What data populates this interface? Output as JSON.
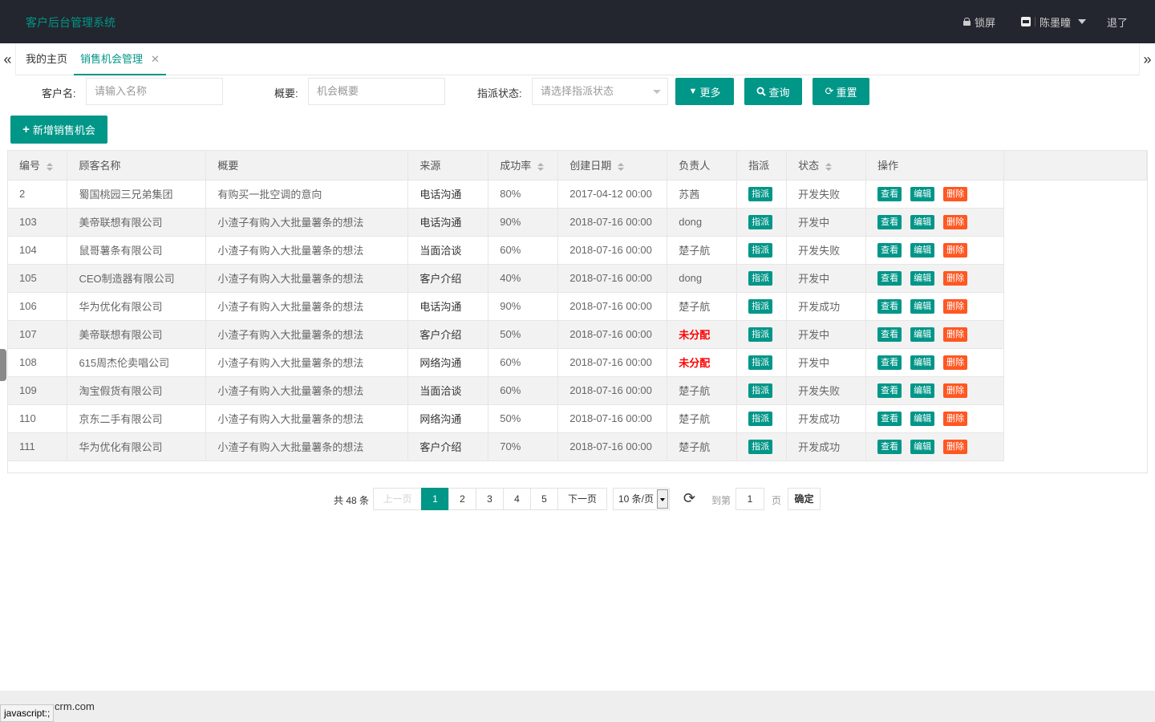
{
  "header": {
    "title": "客户后台管理系统",
    "lock": "锁屏",
    "user": "陈墨瞳",
    "logout": "退了"
  },
  "tabs": {
    "home": "我的主页",
    "active": "销售机会管理",
    "close": "✕"
  },
  "search": {
    "customer_label": "客户名:",
    "customer_placeholder": "请输入名称",
    "summary_label": "概要:",
    "summary_placeholder": "机会概要",
    "status_label": "指派状态:",
    "status_placeholder": "请选择指派状态",
    "more": "更多",
    "query": "查询",
    "reset": "重置"
  },
  "add_button": "新增销售机会",
  "table": {
    "headers": [
      "编号",
      "顾客名称",
      "概要",
      "来源",
      "成功率",
      "创建日期",
      "负责人",
      "指派",
      "状态",
      "操作"
    ],
    "rows": [
      {
        "id": "2",
        "name": "蜀国桃园三兄弟集团",
        "summary": "有购买一批空调的意向",
        "source": "电话沟通",
        "rate": "80%",
        "date": "2017-04-12 00:00",
        "owner": "苏茜",
        "status": "开发失败"
      },
      {
        "id": "103",
        "name": "美帝联想有限公司",
        "summary": "小渣子有购入大批量薯条的想法",
        "source": "电话沟通",
        "rate": "90%",
        "date": "2018-07-16 00:00",
        "owner": "dong",
        "status": "开发中"
      },
      {
        "id": "104",
        "name": "鼠哥薯条有限公司",
        "summary": "小渣子有购入大批量薯条的想法",
        "source": "当面洽谈",
        "rate": "60%",
        "date": "2018-07-16 00:00",
        "owner": "楚子航",
        "status": "开发失败"
      },
      {
        "id": "105",
        "name": "CEO制造器有限公司",
        "summary": "小渣子有购入大批量薯条的想法",
        "source": "客户介绍",
        "rate": "40%",
        "date": "2018-07-16 00:00",
        "owner": "dong",
        "status": "开发中"
      },
      {
        "id": "106",
        "name": "华为优化有限公司",
        "summary": "小渣子有购入大批量薯条的想法",
        "source": "电话沟通",
        "rate": "90%",
        "date": "2018-07-16 00:00",
        "owner": "楚子航",
        "status": "开发成功"
      },
      {
        "id": "107",
        "name": "美帝联想有限公司",
        "summary": "小渣子有购入大批量薯条的想法",
        "source": "客户介绍",
        "rate": "50%",
        "date": "2018-07-16 00:00",
        "owner": "未分配",
        "status": "开发中"
      },
      {
        "id": "108",
        "name": "615周杰伦卖唱公司",
        "summary": "小渣子有购入大批量薯条的想法",
        "source": "网络沟通",
        "rate": "60%",
        "date": "2018-07-16 00:00",
        "owner": "未分配",
        "status": "开发中"
      },
      {
        "id": "109",
        "name": "淘宝假货有限公司",
        "summary": "小渣子有购入大批量薯条的想法",
        "source": "当面洽谈",
        "rate": "60%",
        "date": "2018-07-16 00:00",
        "owner": "楚子航",
        "status": "开发失败"
      },
      {
        "id": "110",
        "name": "京东二手有限公司",
        "summary": "小渣子有购入大批量薯条的想法",
        "source": "网络沟通",
        "rate": "50%",
        "date": "2018-07-16 00:00",
        "owner": "楚子航",
        "status": "开发成功"
      },
      {
        "id": "111",
        "name": "华为优化有限公司",
        "summary": "小渣子有购入大批量薯条的想法",
        "source": "客户介绍",
        "rate": "70%",
        "date": "2018-07-16 00:00",
        "owner": "楚子航",
        "status": "开发成功"
      }
    ],
    "assign_label": "指派",
    "view_label": "查看",
    "edit_label": "编辑",
    "delete_label": "删除",
    "unassigned": "未分配"
  },
  "pager": {
    "total": "共 48 条",
    "prev": "上一页",
    "pages": [
      "1",
      "2",
      "3",
      "4",
      "5"
    ],
    "current": "1",
    "next": "下一页",
    "page_size": "10 条/页",
    "goto_label": "到第",
    "goto_value": "1",
    "page_unit": "页",
    "confirm": "确定"
  },
  "footer": {
    "text": "crm.com",
    "status_link": "javascript:;"
  },
  "colors": {
    "accent": "#009688",
    "danger": "#ff5722",
    "header_bg": "#23262e"
  }
}
